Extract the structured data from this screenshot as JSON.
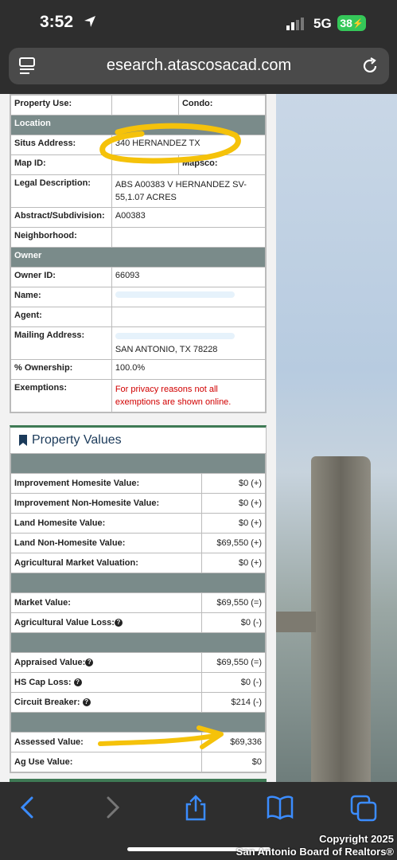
{
  "status_bar": {
    "time": "3:52",
    "network": "5G",
    "battery": "38"
  },
  "browser": {
    "url": "esearch.atascosacad.com"
  },
  "property_info": {
    "rows": [
      {
        "label": "Property Use:",
        "value": "",
        "label2": "Condo:",
        "value2": ""
      },
      {
        "header": "Location"
      },
      {
        "label": "Situs Address:",
        "value": "340 HERNANDEZ  TX"
      },
      {
        "label": "Map ID:",
        "value": "",
        "label2": "Mapsco:",
        "value2": ""
      },
      {
        "label": "Legal Description:",
        "value": "ABS A00383 V HERNANDEZ SV-55,1.07 ACRES"
      },
      {
        "label": "Abstract/Subdivision:",
        "value": "A00383"
      },
      {
        "label": "Neighborhood:",
        "value": ""
      },
      {
        "header": "Owner"
      },
      {
        "label": "Owner ID:",
        "value": "66093"
      },
      {
        "label": "Name:",
        "value": ""
      },
      {
        "label": "Agent:",
        "value": ""
      },
      {
        "label": "Mailing Address:",
        "value": "SAN ANTONIO, TX 78228"
      },
      {
        "label": "% Ownership:",
        "value": "100.0%"
      },
      {
        "label": "Exemptions:",
        "value": "For privacy reasons not all exemptions are shown online."
      }
    ]
  },
  "property_values": {
    "title": "Property Values",
    "rows": [
      {
        "spacer": true
      },
      {
        "label": "Improvement Homesite Value:",
        "value": "$0 (+)"
      },
      {
        "label": "Improvement Non-Homesite Value:",
        "value": "$0 (+)"
      },
      {
        "label": "Land Homesite Value:",
        "value": "$0 (+)"
      },
      {
        "label": "Land Non-Homesite Value:",
        "value": "$69,550 (+)"
      },
      {
        "label": "Agricultural Market Valuation:",
        "value": "$0 (+)"
      },
      {
        "spacer": true
      },
      {
        "label": "Market Value:",
        "value": "$69,550 (=)"
      },
      {
        "label": "Agricultural Value Loss:",
        "value": "$0 (-)",
        "help": true
      },
      {
        "spacer": true
      },
      {
        "label": "Appraised Value:",
        "value": "$69,550 (=)",
        "help": true
      },
      {
        "label": "HS Cap Loss: ",
        "value": "$0 (-)",
        "help": true
      },
      {
        "label": "Circuit Breaker: ",
        "value": "$214 (-)",
        "help": true
      },
      {
        "spacer": true
      },
      {
        "label": "Assessed Value:",
        "value": "$69,336"
      },
      {
        "label": "Ag Use Value:",
        "value": "$0"
      }
    ]
  },
  "watermark": {
    "line1": "Copyright 2025",
    "line2": "San Antonio Board of Realtors®"
  },
  "colors": {
    "header_bg": "#7a8b8a",
    "accent_green": "#3f7a55",
    "highlight": "#f5c20a",
    "warning_red": "#d10000"
  }
}
